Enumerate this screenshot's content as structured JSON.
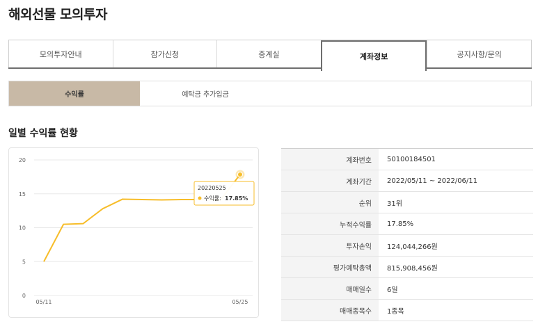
{
  "page": {
    "title": "해외선물 모의투자"
  },
  "main_tabs": [
    {
      "label": "모의투자안내",
      "active": false
    },
    {
      "label": "참가신청",
      "active": false
    },
    {
      "label": "중계실",
      "active": false
    },
    {
      "label": "계좌정보",
      "active": true
    },
    {
      "label": "공지사항/문의",
      "active": false
    }
  ],
  "sub_tabs": [
    {
      "label": "수익률",
      "active": true
    },
    {
      "label": "예탁금 추가입금",
      "active": false
    }
  ],
  "section": {
    "title": "일별 수익률 현황"
  },
  "chart_data": {
    "type": "line",
    "x": [
      "20220511",
      "20220512",
      "20220513",
      "20220516",
      "20220517",
      "20220518",
      "20220519",
      "20220520",
      "20220523",
      "20220524",
      "20220525"
    ],
    "x_tick_labels": [
      "05/11",
      "05/25"
    ],
    "y_ticks": [
      "0",
      "5",
      "10",
      "15",
      "20"
    ],
    "ylim": [
      0,
      20
    ],
    "grid": true,
    "series": [
      {
        "name": "수익률",
        "values": [
          5.0,
          10.5,
          10.6,
          12.8,
          14.2,
          14.15,
          14.1,
          14.15,
          14.15,
          14.1,
          17.85
        ]
      }
    ],
    "tooltip": {
      "date": "20220525",
      "series_label": "수익률",
      "value_label": "17.85%"
    },
    "colors": {
      "line": "#f7bd2a",
      "tooltip_border": "#f7bd2a",
      "grid": "#e8e8e8"
    }
  },
  "info": {
    "rows": [
      {
        "label": "계좌번호",
        "value": "50100184501"
      },
      {
        "label": "계좌기간",
        "value": "2022/05/11 ~ 2022/06/11"
      },
      {
        "label": "순위",
        "value": "31위"
      },
      {
        "label": "누적수익률",
        "value": "17.85%"
      },
      {
        "label": "투자손익",
        "value": "124,044,266원"
      },
      {
        "label": "평가예탁총액",
        "value": "815,908,456원"
      },
      {
        "label": "매매일수",
        "value": "6일"
      },
      {
        "label": "매매종목수",
        "value": "1종목"
      }
    ]
  }
}
